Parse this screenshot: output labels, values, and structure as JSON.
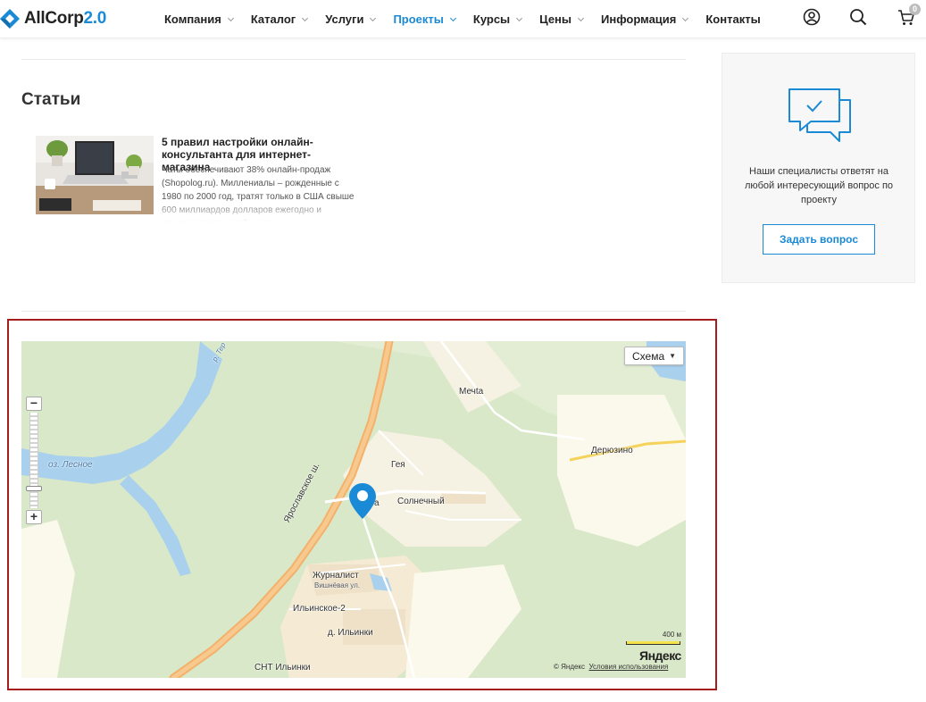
{
  "header": {
    "logo_text": "AllCorp",
    "logo_version": "2.0",
    "nav": [
      {
        "label": "Компания",
        "has_caret": true,
        "active": false
      },
      {
        "label": "Каталог",
        "has_caret": true,
        "active": false
      },
      {
        "label": "Услуги",
        "has_caret": true,
        "active": false
      },
      {
        "label": "Проекты",
        "has_caret": true,
        "active": true
      },
      {
        "label": "Курсы",
        "has_caret": true,
        "active": false
      },
      {
        "label": "Цены",
        "has_caret": true,
        "active": false
      },
      {
        "label": "Информация",
        "has_caret": true,
        "active": false
      },
      {
        "label": "Контакты",
        "has_caret": false,
        "active": false
      }
    ],
    "icons": [
      "user-icon",
      "search-icon",
      "cart-icon"
    ],
    "cart_count": "0"
  },
  "articles": {
    "title": "Статьи",
    "items": [
      {
        "title": "5 правил настройки онлайн-консультанта для интернет-магазина",
        "text": "Чаты обеспечивают 38% онлайн-продаж (Shopolog.ru). Миллениалы – рожденные с 1980 по 2000 год, тратят только в США свыше 600 миллиардов долларов ежегодно и предпочитают онлайн-чаты"
      }
    ]
  },
  "sidebar": {
    "text": "Наши специалисты ответят на любой интересующий вопрос по проекту",
    "button_label": "Задать вопрос"
  },
  "map": {
    "type_button": "Схема",
    "zoom_in": "+",
    "zoom_out": "−",
    "labels": {
      "mechta": "Мечta",
      "deryuzino": "Дерюзино",
      "geya": "Гея",
      "solnechny": "Солнечный",
      "partial_a": "а",
      "yaroslavskoe": "Ярославское ш.",
      "lake": "оз. Лесное",
      "river": "р. Тер",
      "zhurnalist": "Журналист",
      "vishnevaya": "Вишнёвая ул.",
      "ilinskoe2": "Ильинское-2",
      "ilinki": "д. Ильинки",
      "snt_ilinki": "СНТ Ильинки"
    },
    "scale_label": "400 м",
    "logo": "Яндекс",
    "copyright": "© Яндекс",
    "terms_link": "Условия использования"
  },
  "colors": {
    "accent": "#1b8ad6",
    "highlight_border": "#a51d1d",
    "map_green": "#d8e8c7",
    "map_road": "#f3b16b",
    "map_water": "#a9d1ee"
  }
}
